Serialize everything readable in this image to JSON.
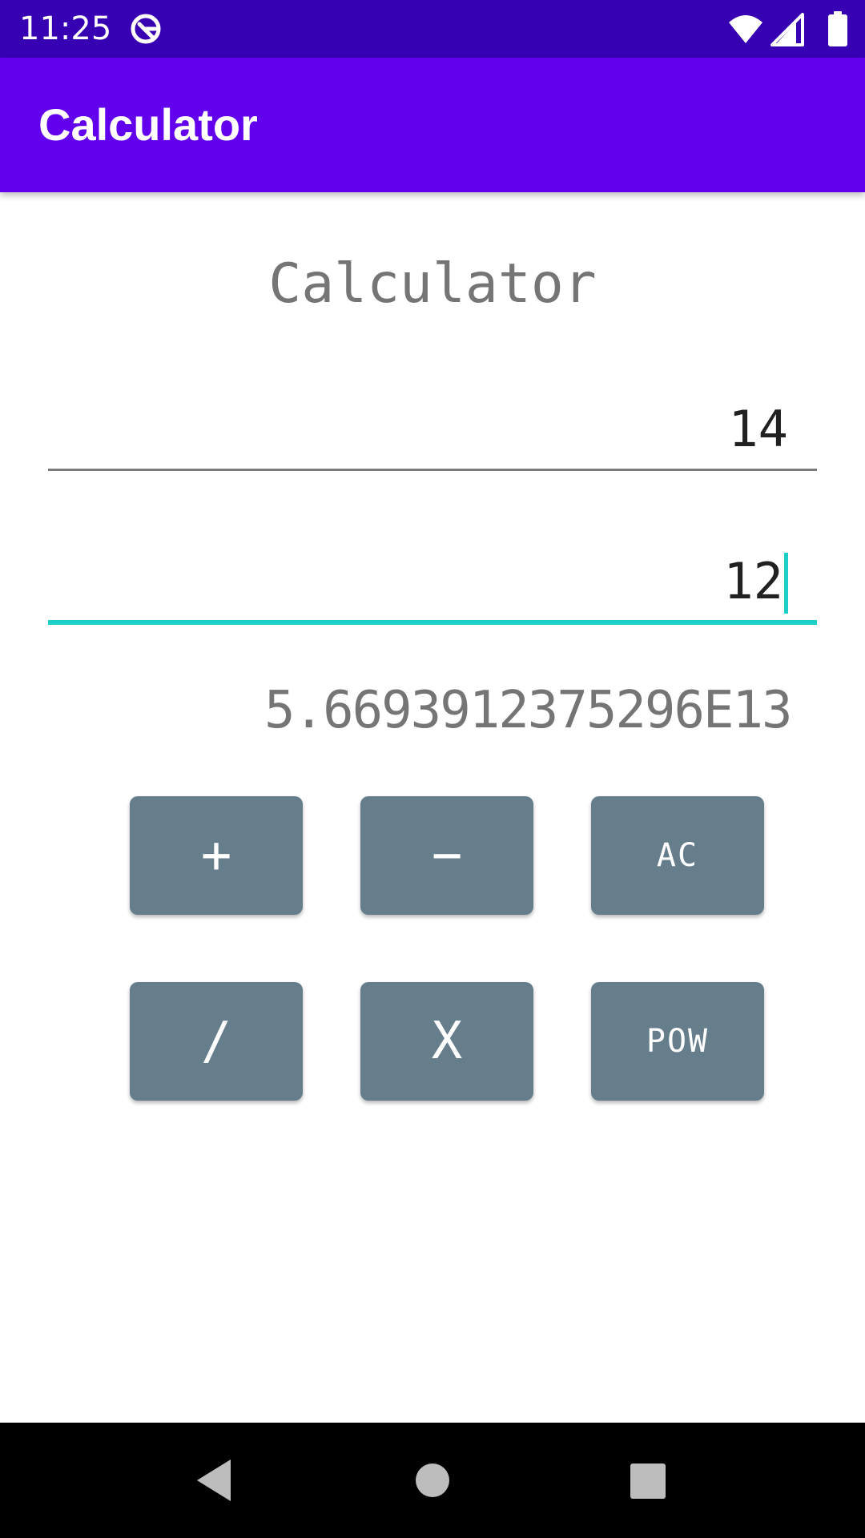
{
  "status_bar": {
    "time": "11:25",
    "icons": [
      "data-saver-icon",
      "wifi-icon",
      "signal-icon",
      "battery-icon"
    ]
  },
  "app_bar": {
    "title": "Calculator",
    "color": "#6200ee",
    "status_color": "#3700b3"
  },
  "main": {
    "heading": "Calculator",
    "first_number": "14",
    "second_number": "12",
    "result": "5.6693912375296E13",
    "accent_color": "#1ccfc9"
  },
  "buttons": {
    "plus": "+",
    "minus": "−",
    "clear": "AC",
    "divide": "/",
    "multiply": "X",
    "power": "POW",
    "color": "#667e8c"
  },
  "nav_bar": {
    "icons": [
      "back-icon",
      "home-icon",
      "recents-icon"
    ]
  }
}
